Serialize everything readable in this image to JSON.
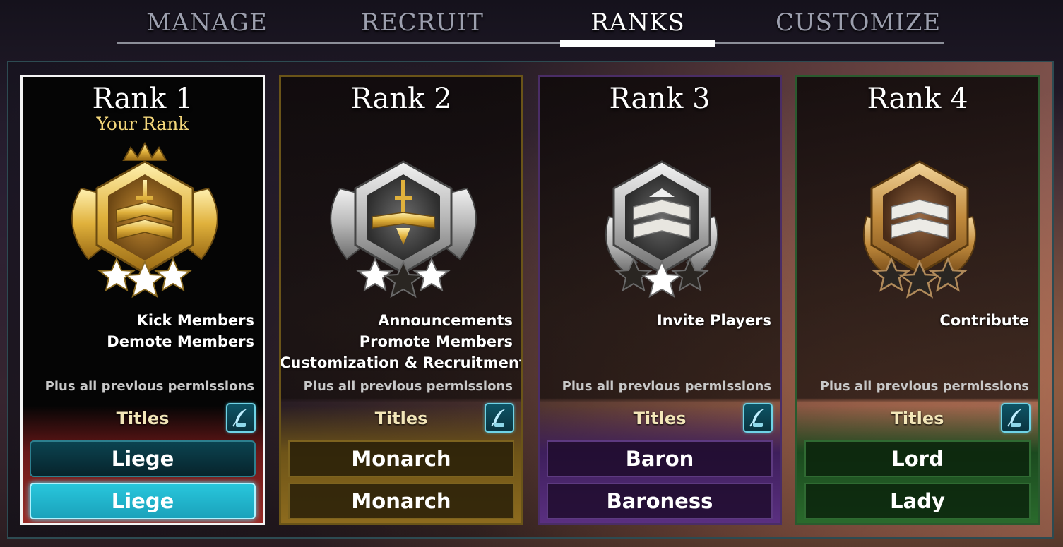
{
  "tabs": [
    {
      "label": "MANAGE"
    },
    {
      "label": "RECRUIT"
    },
    {
      "label": "RANKS"
    },
    {
      "label": "CUSTOMIZE"
    }
  ],
  "active_tab": "RANKS",
  "plus_text": "Plus all previous permissions",
  "titles_label": "Titles",
  "colors": {
    "rank1_accent": "#9a2a26",
    "rank2_accent": "#8d6b1e",
    "rank3_accent": "#5a2f80",
    "rank4_accent": "#2a6a2c",
    "selected_title": "#28c6dc"
  },
  "ranks": [
    {
      "title": "Rank 1",
      "subtitle": "Your Rank",
      "emblem": "gold-crowned-rank-emblem-icon",
      "stars_filled": 3,
      "permissions": [
        "Kick Members",
        "Demote Members"
      ],
      "titles": [
        "Liege",
        "Liege"
      ]
    },
    {
      "title": "Rank 2",
      "emblem": "silver-sword-rank-emblem-icon",
      "stars_filled": 2,
      "permissions": [
        "Announcements",
        "Promote Members",
        "Customization & Recruitment"
      ],
      "titles": [
        "Monarch",
        "Monarch"
      ]
    },
    {
      "title": "Rank 3",
      "emblem": "silver-rank-emblem-icon",
      "stars_filled": 1,
      "permissions": [
        "Invite Players"
      ],
      "titles": [
        "Baron",
        "Baroness"
      ]
    },
    {
      "title": "Rank 4",
      "emblem": "bronze-rank-emblem-icon",
      "stars_filled": 0,
      "permissions": [
        "Contribute"
      ],
      "titles": [
        "Lord",
        "Lady"
      ]
    }
  ]
}
